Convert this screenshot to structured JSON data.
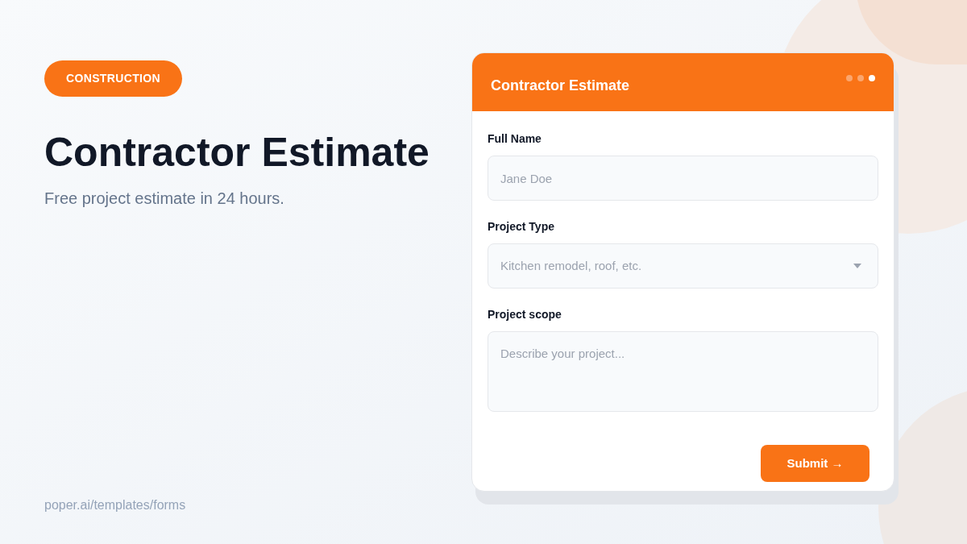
{
  "badge": "CONSTRUCTION",
  "title": "Contractor Estimate",
  "subtitle": "Free project estimate in 24 hours.",
  "footer": "poper.ai/templates/forms",
  "form": {
    "title": "Contractor Estimate",
    "steps": [
      {
        "selected": false
      },
      {
        "selected": false
      },
      {
        "selected": true
      }
    ],
    "fields": [
      {
        "kind": "text",
        "label": "Full Name",
        "placeholder": "Jane Doe"
      },
      {
        "kind": "select",
        "label": "Project Type",
        "placeholder": "Kitchen remodel, roof, etc."
      },
      {
        "kind": "textarea",
        "label": "Project scope",
        "placeholder": "Describe your project..."
      }
    ],
    "submit": "Submit →"
  }
}
